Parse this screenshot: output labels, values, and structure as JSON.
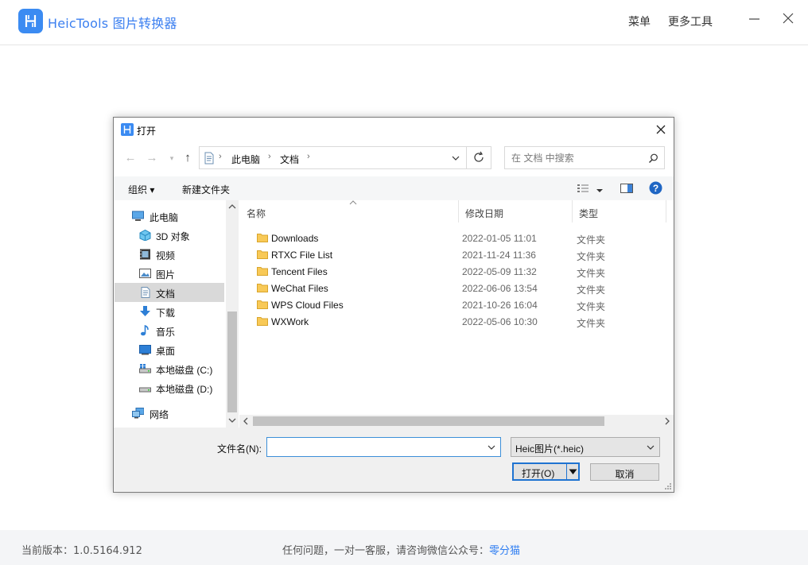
{
  "app": {
    "title": "HeicTools 图片转换器",
    "menu_label": "菜单",
    "more_tools_label": "更多工具"
  },
  "footer": {
    "version": "当前版本：1.0.5164.912",
    "help_text": "任何问题，一对一客服，请咨询微信公众号：",
    "help_link": "零分猫"
  },
  "dialog": {
    "title": "打开",
    "breadcrumb": [
      "此电脑",
      "文档"
    ],
    "search_placeholder": "在 文档 中搜索",
    "toolbar": {
      "organize_label": "组织 ▾",
      "new_folder_label": "新建文件夹"
    },
    "nav": [
      {
        "label": "此电脑",
        "icon": "computer-icon"
      },
      {
        "label": "3D 对象",
        "icon": "3d-objects-icon"
      },
      {
        "label": "视频",
        "icon": "video-icon"
      },
      {
        "label": "图片",
        "icon": "pictures-icon"
      },
      {
        "label": "文档",
        "icon": "documents-icon",
        "selected": true
      },
      {
        "label": "下载",
        "icon": "download-icon"
      },
      {
        "label": "音乐",
        "icon": "music-icon"
      },
      {
        "label": "桌面",
        "icon": "desktop-icon"
      },
      {
        "label": "本地磁盘 (C:)",
        "icon": "drive-icon"
      },
      {
        "label": "本地磁盘 (D:)",
        "icon": "drive-icon"
      },
      {
        "label": "网络",
        "icon": "network-icon"
      }
    ],
    "columns": {
      "name": "名称",
      "modified": "修改日期",
      "type": "类型"
    },
    "files": [
      {
        "name": "Downloads",
        "modified": "2022-01-05 11:01",
        "type": "文件夹"
      },
      {
        "name": "RTXC File List",
        "modified": "2021-11-24 11:36",
        "type": "文件夹"
      },
      {
        "name": "Tencent Files",
        "modified": "2022-05-09 11:32",
        "type": "文件夹"
      },
      {
        "name": "WeChat Files",
        "modified": "2022-06-06 13:54",
        "type": "文件夹"
      },
      {
        "name": "WPS Cloud Files",
        "modified": "2021-10-26 16:04",
        "type": "文件夹"
      },
      {
        "name": "WXWork",
        "modified": "2022-05-06 10:30",
        "type": "文件夹"
      }
    ],
    "filename_label": "文件名(N):",
    "filename_value": "",
    "filetype_selected": "Heic图片(*.heic)",
    "open_label": "打开(O)",
    "cancel_label": "取消",
    "colors": {
      "accent": "#1f73d1",
      "folder": "#f8c957",
      "selection": "#d9d9d9"
    }
  }
}
